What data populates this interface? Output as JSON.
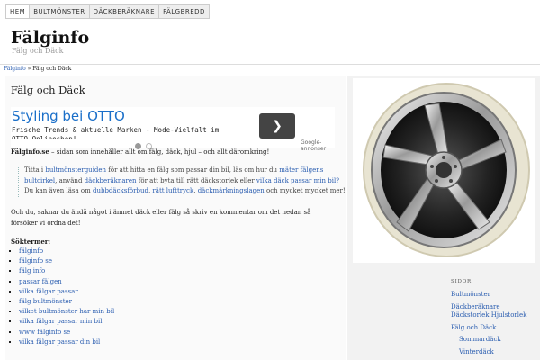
{
  "nav": [
    {
      "label": "HEM",
      "active": true
    },
    {
      "label": "BULTMÖNSTER",
      "active": false
    },
    {
      "label": "DÄCKBERÄKNARE",
      "active": false
    },
    {
      "label": "FÄLGBREDD",
      "active": false
    }
  ],
  "site": {
    "title": "Fälginfo",
    "tagline": "Fälg och Däck"
  },
  "breadcrumb": {
    "home": "Fälginfo",
    "separator": "»",
    "current": "Fälg och Däck"
  },
  "page": {
    "title": "Fälg och Däck"
  },
  "ad": {
    "title": "Styling bei OTTO",
    "line1": "Frische Trends & aktuelle Marken - Mode-Vielfalt im",
    "line2": "OTTO Onlineshop!",
    "button": "❯",
    "brand": "Google-annonser"
  },
  "intro": {
    "bold": "Fälginfo.se",
    "text": " – sidan som innehåller allt om fälg, däck, hjul – och allt däromkring!"
  },
  "quote": {
    "t1": "Titta i ",
    "l1": "bultmönsterguiden",
    "t2": " för att hitta en fälg som passar din bil, läs om hur du ",
    "l2": "mäter fälgens bultcirkel",
    "t3": ", använd ",
    "l3": "däckberäknaren",
    "t4": " för att byta till rätt däckstorlek eller ",
    "l4": "vilka däck passar min bil?",
    "t5": " Du kan även läsa om ",
    "l5": "dubbdäcksförbud",
    "t6": ", ",
    "l6": "rätt lufttryck",
    "t7": ", ",
    "l7": "däckmärkningslagen",
    "t8": " och mycket mycket mer!"
  },
  "para": "Och du, saknar du ändå något i ämnet däck eller fälg så skriv en kommentar om det nedan så försöker vi ordna det!",
  "search_label": "Söktermer:",
  "search_terms": [
    "fälginfo",
    "fälginfo se",
    "fälg info",
    "passar fälgen",
    "vilka fälgar passar",
    "fälg bultmönster",
    "vilket bultmönster har min bil",
    "vilka fälgar passar min bil",
    "www fälginfo se",
    "vilka fälgar passar din bil"
  ],
  "sidebar": {
    "heading": "SIDOR",
    "items": [
      "Bultmönster",
      "Däckberäknare Däckstorlek Hjulstorlek",
      "Fälg och Däck",
      "Sommardäck",
      "Vinterdäck"
    ]
  },
  "colors": {
    "link": "#2a5db0",
    "ad_title": "#1a6fc9"
  }
}
